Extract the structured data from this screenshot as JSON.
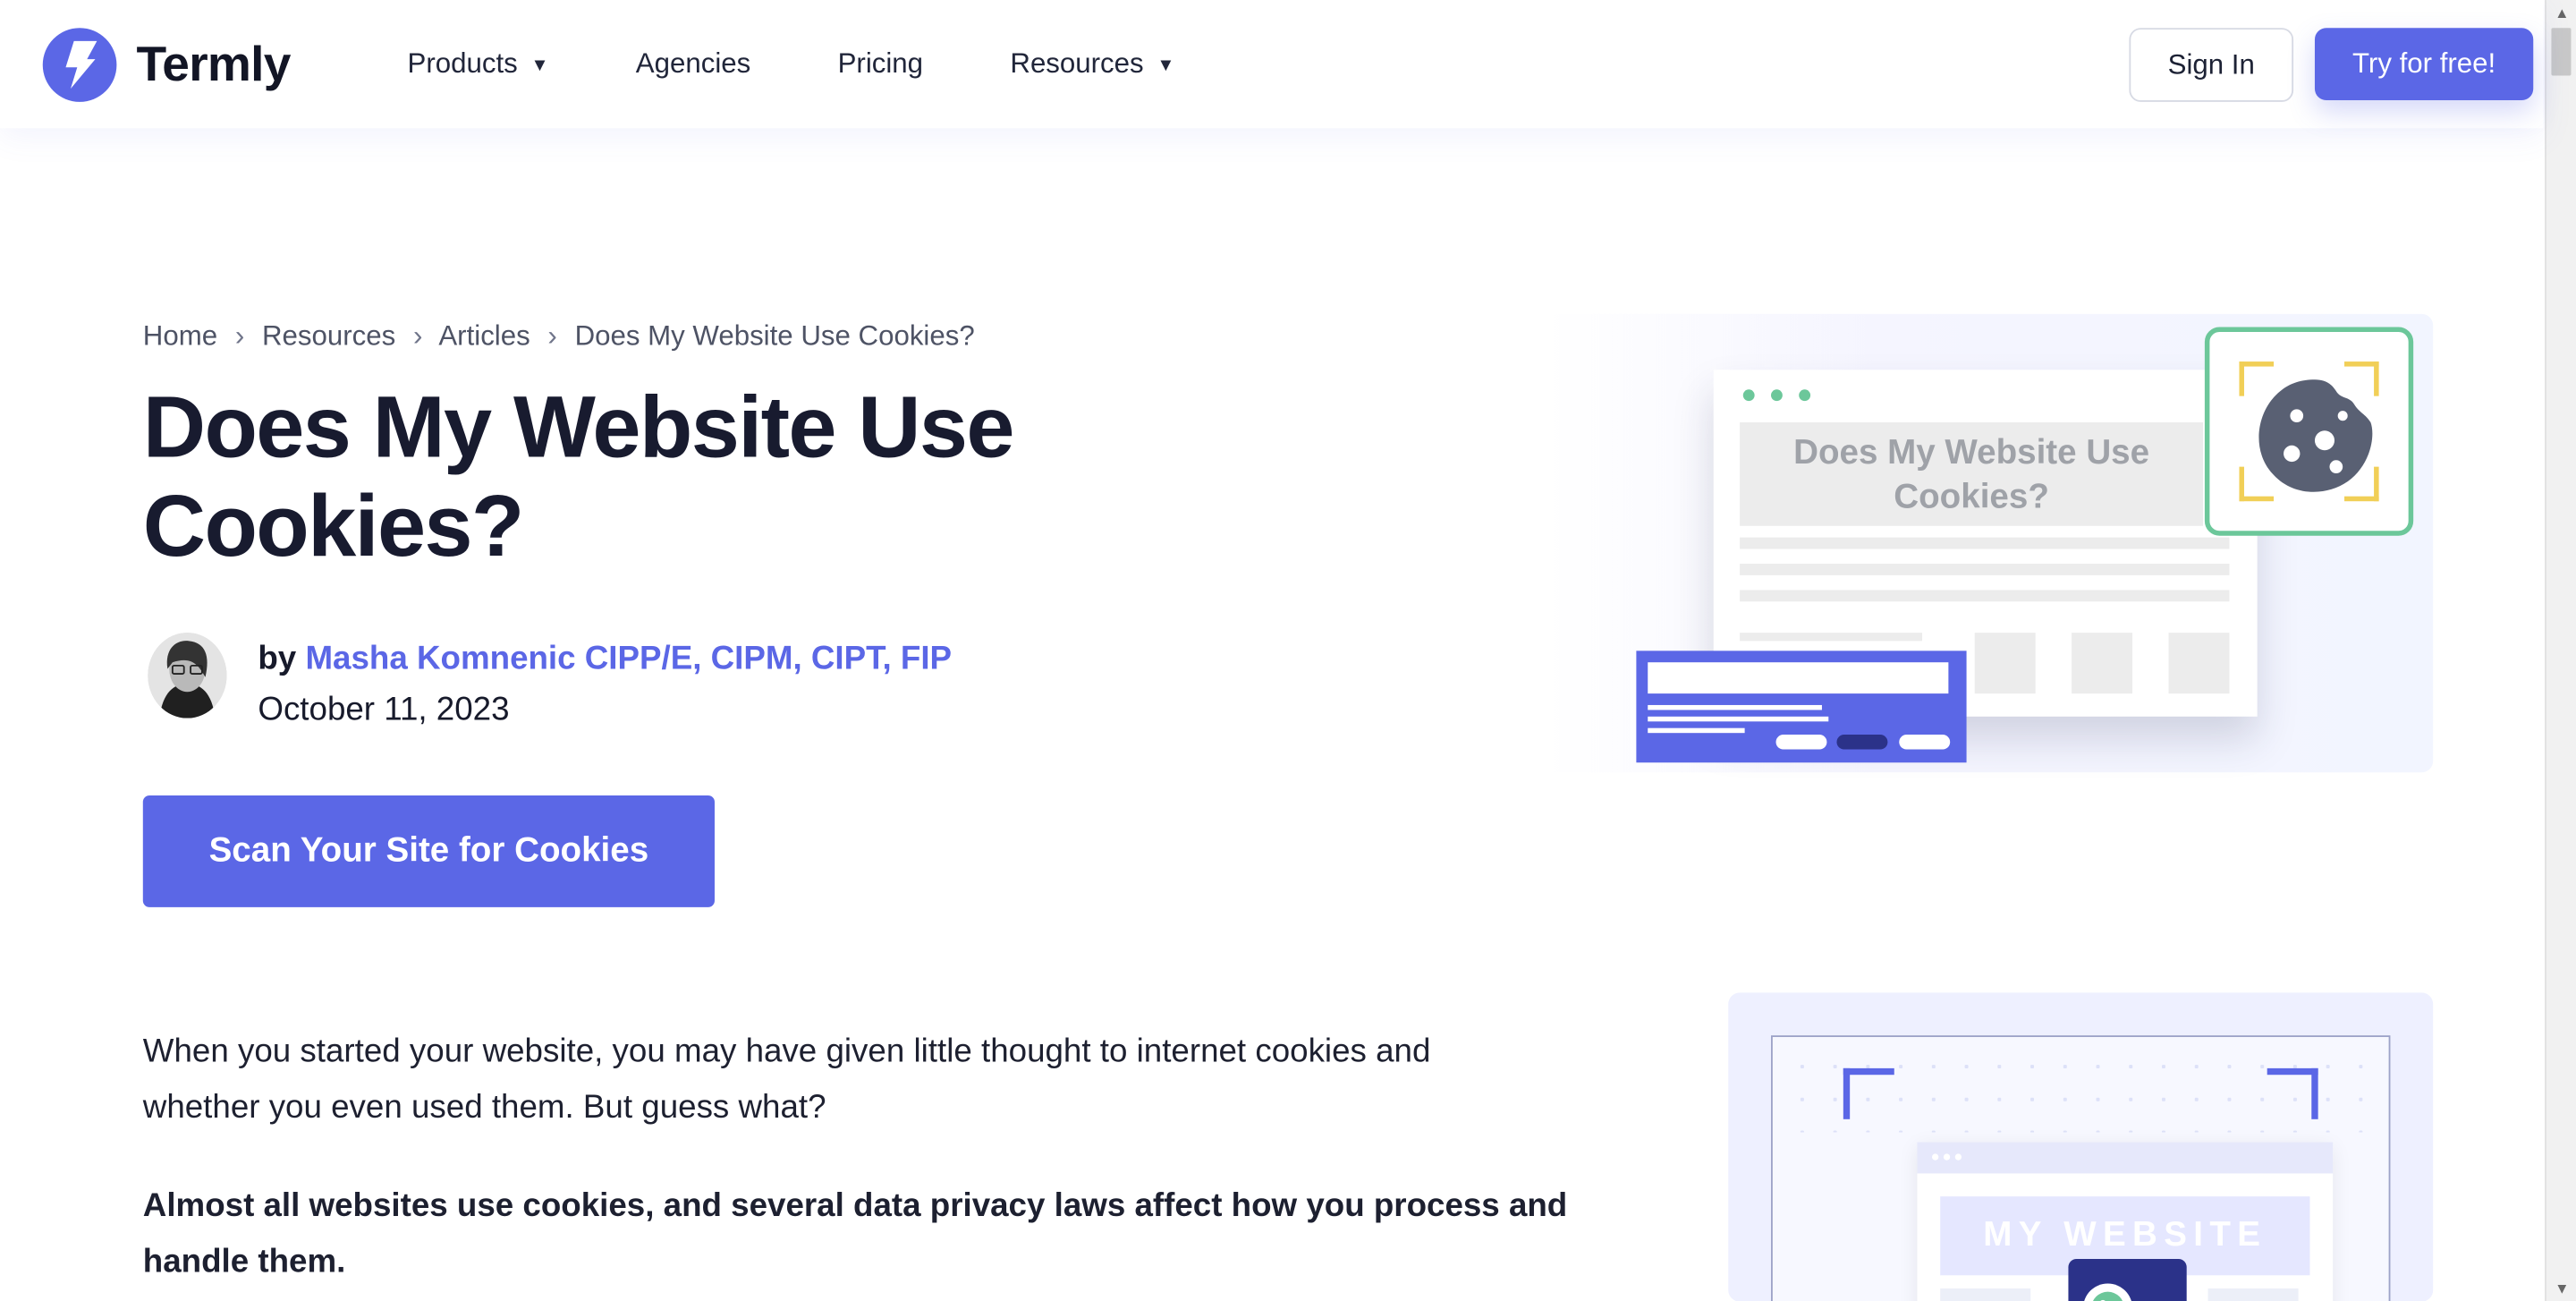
{
  "header": {
    "brand": "Termly",
    "nav": [
      {
        "label": "Products",
        "dropdown": true
      },
      {
        "label": "Agencies",
        "dropdown": false
      },
      {
        "label": "Pricing",
        "dropdown": false
      },
      {
        "label": "Resources",
        "dropdown": true
      }
    ],
    "sign_in": "Sign In",
    "try_free": "Try for free!"
  },
  "breadcrumb": [
    "Home",
    "Resources",
    "Articles",
    "Does My Website Use Cookies?"
  ],
  "article": {
    "title": "Does My Website Use Cookies?",
    "author_prefix": "by",
    "author": "Masha Komnenic CIPP/E, CIPM, CIPT, FIP",
    "date": "October 11, 2023",
    "cta": "Scan Your Site for Cookies",
    "intro": "When you started your website, you may have given little thought to internet cookies and whether you even used them. But guess what?",
    "bold_paragraph": "Almost all websites use cookies, and several data privacy laws affect how you process and handle them."
  },
  "illustration": {
    "window_title": "Does My Website Use Cookies?",
    "secondary_title": "MY WEBSITE"
  },
  "icons": {
    "logo": "bolt-logo-icon",
    "dropdown": "chevron-down-icon",
    "cookie": "cookie-icon",
    "scroll_up": "scroll-up-icon",
    "scroll_down": "scroll-down-icon"
  },
  "colors": {
    "accent": "#5b67e6",
    "text": "#171a2b",
    "green": "#6cc79a",
    "yellow": "#f1cf57",
    "cookie": "#596073"
  }
}
